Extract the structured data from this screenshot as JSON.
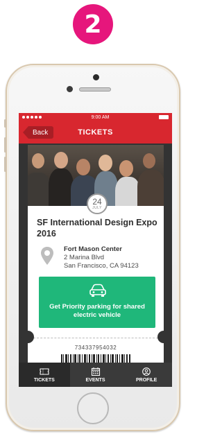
{
  "step": {
    "number": "2"
  },
  "statusbar": {
    "time": "9:00 AM"
  },
  "navbar": {
    "back_label": "Back",
    "title": "TICKETS"
  },
  "event": {
    "date_day": "24",
    "date_month": "JULY",
    "title": "SF International Design Expo 2016",
    "venue_name": "Fort Mason Center",
    "address_line1": "2 Marina Blvd",
    "address_line2": "San Francisco, CA 94123"
  },
  "parking": {
    "label": "Get Priority parking for shared electric vehicle"
  },
  "ticket": {
    "barcode_number": "734337954032"
  },
  "tabbar": {
    "tabs": [
      {
        "label": "TICKETS",
        "icon": "ticket-icon"
      },
      {
        "label": "EVENTS",
        "icon": "calendar-icon"
      },
      {
        "label": "PROFILE",
        "icon": "user-icon"
      }
    ]
  },
  "colors": {
    "accent_red": "#d8272f",
    "badge_pink": "#e6167c",
    "parking_green": "#1fb77a",
    "tabbar_dark": "#3a3a3a"
  }
}
